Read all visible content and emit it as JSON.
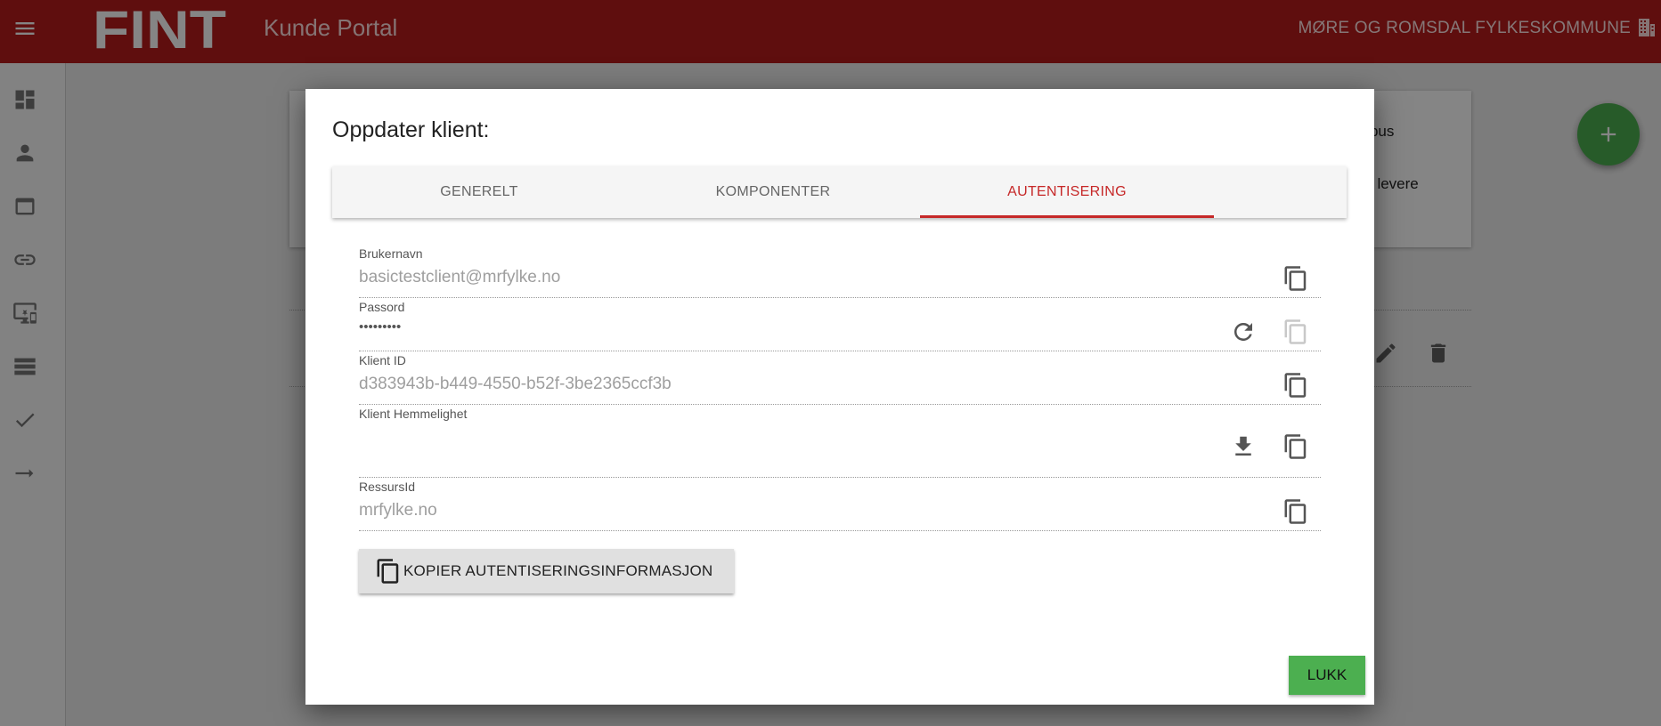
{
  "header": {
    "logo_text": "FINT",
    "title": "Kunde Portal",
    "organization": "MØRE OG ROMSDAL FYLKESKOMMUNE",
    "background_color": "#b71c1c"
  },
  "sidebar": {
    "items": [
      {
        "icon": "dashboard-icon"
      },
      {
        "icon": "person-icon"
      },
      {
        "icon": "web-window-icon"
      },
      {
        "icon": "link-icon"
      },
      {
        "icon": "monitor-star-icon"
      },
      {
        "icon": "list-icon"
      },
      {
        "icon": "check-icon"
      },
      {
        "icon": "arrow-right-icon"
      }
    ]
  },
  "background": {
    "card_text_1": "nsbus",
    "card_text_2": "kal levere"
  },
  "dialog": {
    "title": "Oppdater klient:",
    "tabs": [
      {
        "label": "GENERELT",
        "active": false
      },
      {
        "label": "KOMPONENTER",
        "active": false
      },
      {
        "label": "AUTENTISERING",
        "active": true
      }
    ],
    "fields": {
      "username": {
        "label": "Brukernavn",
        "value": "basictestclient@mrfylke.no"
      },
      "password": {
        "label": "Passord",
        "value": "•••••••••"
      },
      "client_id": {
        "label": "Klient ID",
        "value": "d383943b-b449-4550-b52f-3be2365ccf3b"
      },
      "client_secret": {
        "label": "Klient Hemmelighet",
        "value": ""
      },
      "resource_id": {
        "label": "RessursId",
        "value": "mrfylke.no"
      }
    },
    "copy_auth_button": "KOPIER AUTENTISERINGSINFORMASJON",
    "close_button": "LUKK"
  },
  "colors": {
    "accent": "#c62828",
    "success": "#4caf50"
  }
}
